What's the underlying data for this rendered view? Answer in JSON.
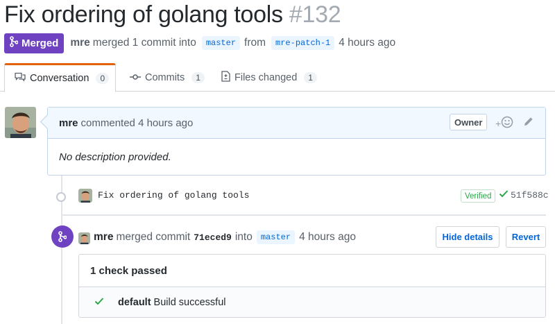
{
  "pr": {
    "title": "Fix ordering of golang tools",
    "number": "#132",
    "state_label": "Merged",
    "author": "mre",
    "summary_text": "merged 1 commit into",
    "base_branch": "master",
    "from_text": "from",
    "head_branch": "mre-patch-1",
    "time_ago": "4 hours ago"
  },
  "tabs": [
    {
      "label": "Conversation",
      "count": "0"
    },
    {
      "label": "Commits",
      "count": "1"
    },
    {
      "label": "Files changed",
      "count": "1"
    }
  ],
  "comment": {
    "author": "mre",
    "action": "commented 4 hours ago",
    "role_badge": "Owner",
    "reaction_plus": "+",
    "body": "No description provided."
  },
  "commit": {
    "message": "Fix ordering of golang tools",
    "verified_label": "Verified",
    "sha": "51f588c"
  },
  "merge_event": {
    "author": "mre",
    "action": "merged commit",
    "sha": "71eced9",
    "into_text": "into",
    "branch": "master",
    "time_ago": "4 hours ago",
    "hide_details_label": "Hide details",
    "revert_label": "Revert"
  },
  "checks": {
    "summary": "1 check passed",
    "items": [
      {
        "name": "default",
        "description": "Build successful",
        "status": "success"
      }
    ]
  },
  "colors": {
    "merged_purple": "#6f42c1",
    "link_blue": "#0366d6",
    "success_green": "#28a745",
    "tab_accent": "#e36209"
  },
  "icons": [
    "git-merge-icon",
    "comment-discussion-icon",
    "git-commit-icon",
    "file-diff-icon",
    "smiley-icon",
    "pencil-icon",
    "check-icon"
  ]
}
